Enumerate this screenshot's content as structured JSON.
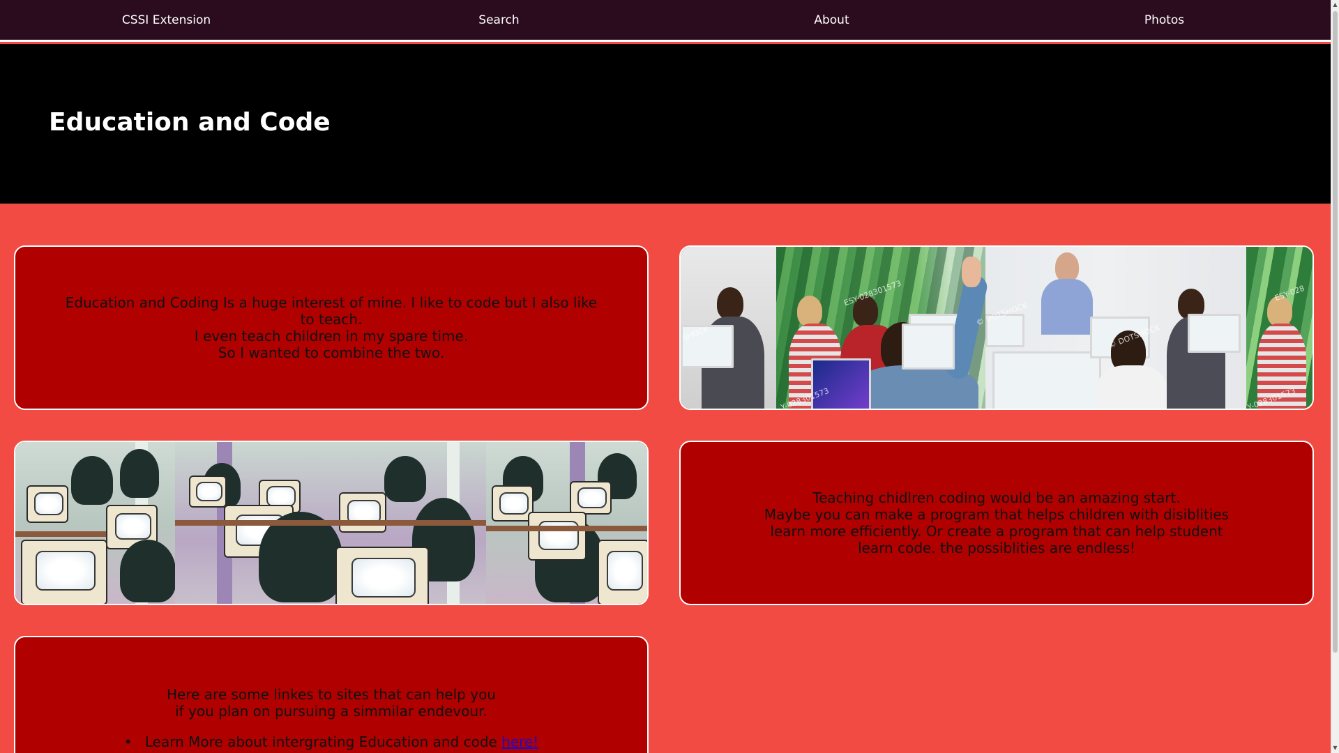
{
  "nav": {
    "items": [
      {
        "label": "CSSI Extension"
      },
      {
        "label": "Search"
      },
      {
        "label": "About"
      },
      {
        "label": "Photos"
      }
    ]
  },
  "header": {
    "title": "Education and Code"
  },
  "cards": {
    "intro": {
      "lines": [
        "Education and Coding Is a huge interest of mine. I like to code but I also like to teach.",
        "I even teach children in my spare time.",
        "So I wanted to combine the two."
      ]
    },
    "teaching": {
      "lines": [
        "Teaching chidlren coding would be an amazing start.",
        "Maybe you can make a program that helps children with disiblities learn more efficiently. Or create a program that can help student learn code. the possiblities are endless!"
      ]
    },
    "links": {
      "intro_line1": "Here are some linkes to sites that can help you",
      "intro_line2": "if you plan on pursuing a simmilar endevour.",
      "items": [
        {
          "text": "Learn More about intergrating Education and code ",
          "link_text": "here!"
        }
      ]
    }
  },
  "photos": {
    "classroom": {
      "watermarks": [
        "ESY-028301573",
        "© DOTSHOCK",
        "© DOTSHOCK",
        "SHOCK",
        "ESY-028",
        "Y-028301573",
        "Y-028301573"
      ]
    }
  },
  "colors": {
    "nav_bg": "#2a0c1e",
    "header_bg": "#000000",
    "page_bg": "#f24b43",
    "card_bg": "#b00000",
    "link": "#1a0dcc"
  }
}
